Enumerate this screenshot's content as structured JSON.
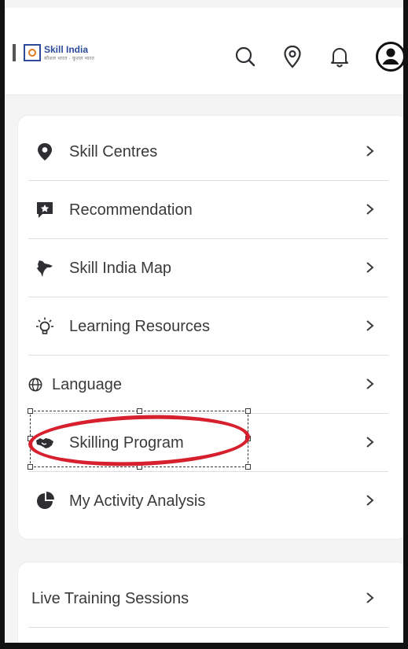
{
  "header": {
    "logo": {
      "brand": "Skill India",
      "tagline": "कौशल भारत - कुशल भारत"
    },
    "icons": [
      "search-icon",
      "location-pin-icon",
      "bell-icon",
      "user-avatar-icon"
    ]
  },
  "menu": {
    "items": [
      {
        "label": "Skill Centres",
        "icon": "skill-centre-pin-icon"
      },
      {
        "label": "Recommendation",
        "icon": "recommendation-icon"
      },
      {
        "label": "Skill India Map",
        "icon": "india-map-icon"
      },
      {
        "label": "Learning Resources",
        "icon": "lightbulb-icon"
      },
      {
        "label": "Language",
        "icon": "globe-icon"
      },
      {
        "label": "Skilling Program",
        "icon": "handshake-icon"
      },
      {
        "label": "My Activity Analysis",
        "icon": "pie-chart-icon"
      }
    ]
  },
  "secondary": {
    "items": [
      {
        "label": "Live Training Sessions"
      }
    ]
  },
  "annotation": {
    "color": "#d6202e",
    "target": "Skilling Program"
  },
  "colors": {
    "text": "#3a3a3d",
    "icon": "#2f2f33",
    "divider": "#dedee2",
    "brand": "#2c4b9a"
  }
}
